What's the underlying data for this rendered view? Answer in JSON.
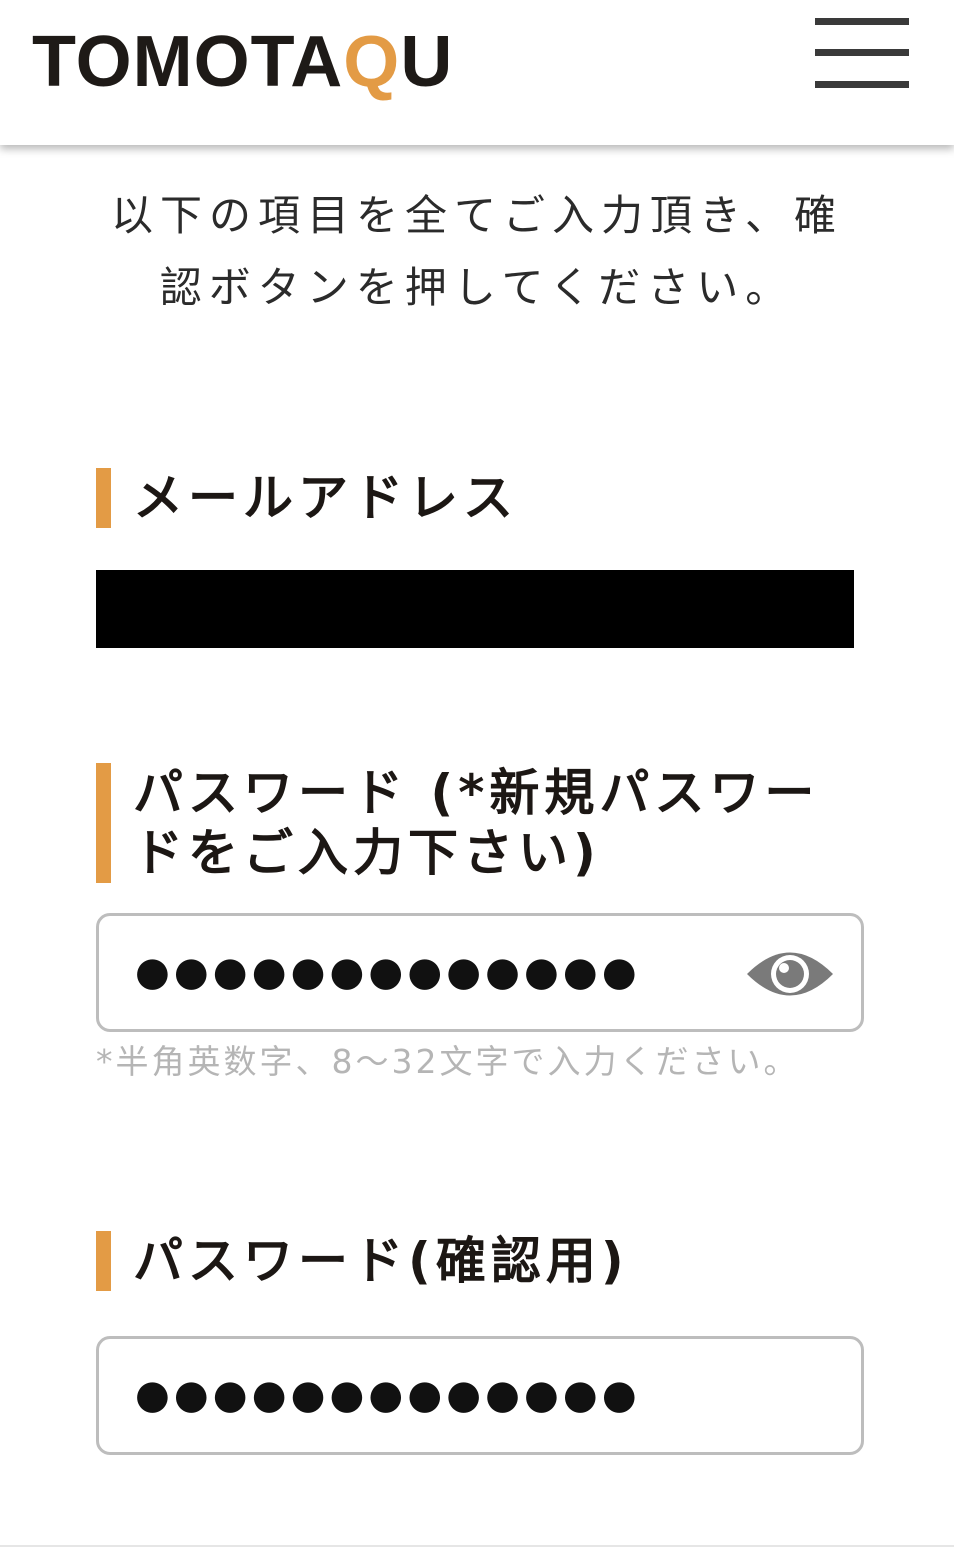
{
  "header": {
    "logo_part1": "TOMOTA",
    "logo_accent": "Q",
    "logo_part2": "U",
    "accent_color": "#e39b45",
    "menu_icon": "hamburger-menu-icon"
  },
  "intro": {
    "line1": "以下の項目を全てご入力頂き、確",
    "line2": "認ボタンを押してください。"
  },
  "email": {
    "label": "メールアドレス",
    "value_redacted": true
  },
  "password": {
    "label": "パスワード (*新規パスワードをご入力下さい)",
    "masked_value": "●●●●●●●●●●●●●",
    "toggle_icon": "eye-icon",
    "hint": "*半角英数字、8〜32文字で入力ください。"
  },
  "password_confirm": {
    "label": "パスワード(確認用)",
    "masked_value": "●●●●●●●●●●●●●"
  }
}
